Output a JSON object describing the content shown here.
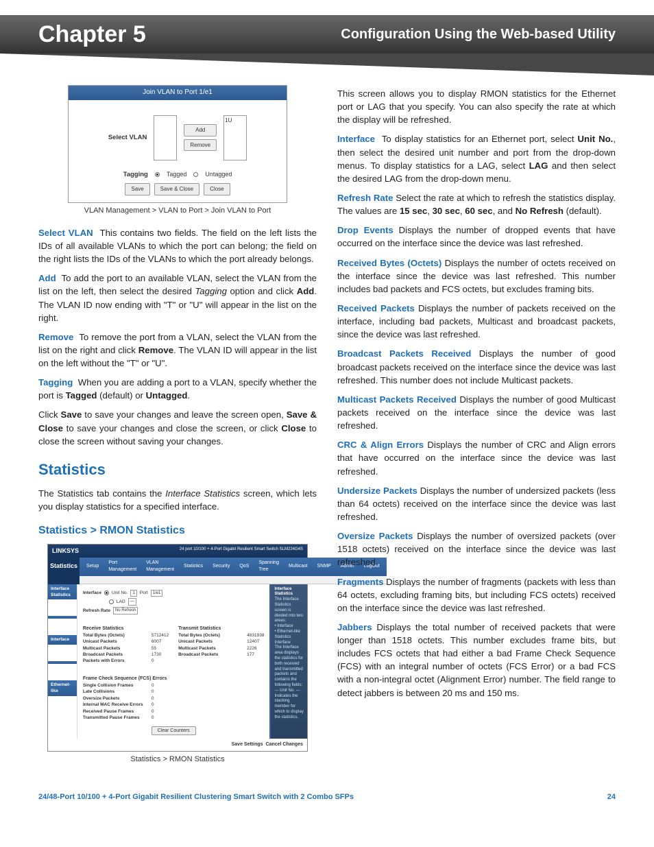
{
  "header": {
    "chapter": "Chapter 5",
    "title": "Configuration Using the Web-based Utility"
  },
  "fig1": {
    "title": "Join VLAN to Port 1/e1",
    "label": "Select VLAN",
    "rightVal": "1U",
    "add": "Add",
    "remove": "Remove",
    "taggingLabel": "Tagging",
    "tagged": "Tagged",
    "untagged": "Untagged",
    "save": "Save",
    "saveClose": "Save & Close",
    "close": "Close",
    "caption": "VLAN Management > VLAN to Port > Join VLAN to Port"
  },
  "left": {
    "selectVlan": {
      "t": "Select VLAN",
      "b": "This contains two fields. The field on the left lists the IDs of all available VLANs to which the port can belong; the field on the right lists the IDs of the VLANs to which the port already belongs."
    },
    "add": {
      "t": "Add",
      "b1": "To add the port to an available VLAN, select the VLAN from the list on the left, then select the desired ",
      "i": "Tagging",
      "b2": " option and click ",
      "bold": "Add",
      "b3": ". The VLAN ID now ending with \"T\" or \"U\" will appear in the list on the right."
    },
    "remove": {
      "t": "Remove",
      "b1": "To remove the port from a VLAN, select the VLAN from the list on the right and click ",
      "bold": "Remove",
      "b2": ". The VLAN ID will appear in the list on the left without the \"T\" or \"U\"."
    },
    "tagging": {
      "t": "Tagging",
      "b1": "When you are adding a port to a VLAN, specify whether the port is ",
      "bold1": "Tagged",
      "mid": " (default) or ",
      "bold2": "Untagged",
      "end": "."
    },
    "closeLine": {
      "a": "Click ",
      "save": "Save",
      "b": " to save your changes and leave the screen open, ",
      "sc": "Save & Close",
      "c": " to save your changes and close the screen, or click ",
      "close": "Close",
      "d": " to close the screen without saving your changes."
    },
    "statsH": "Statistics",
    "statsP": {
      "a": "The Statistics tab contains the ",
      "i": "Interface Statistics",
      "b": " screen, which lets you display statistics for a specified interface."
    },
    "rmonH": "Statistics > RMON Statistics",
    "fig2Caption": "Statistics > RMON Statistics"
  },
  "fig2": {
    "brand": "LINKSYS",
    "model": "24 port 10/100 + 4-Port Gigabit Resilient Smart Switch    SLM224G4S",
    "sideTab": "Statistics",
    "navTabs": [
      "Setup",
      "Port Management",
      "VLAN Management",
      "Statistics",
      "Security",
      "QoS",
      "Spanning Tree",
      "Multicast",
      "SNMP",
      "Admin",
      "LogOut"
    ],
    "sideItems": [
      "Interface Statistics",
      "",
      "Interface",
      "",
      "Ethernet-like"
    ],
    "ifaceLabel": "Interface",
    "unit": "Unit No.",
    "unitV": "1",
    "port": "Port",
    "portV": "1/e1",
    "lag": "LAG",
    "refresh": "Refresh Rate",
    "refreshV": "No Refresh",
    "recvH": "Receive Statistics",
    "transH": "Transmit Statistics",
    "recvRows": [
      [
        "Total Bytes (Octets)",
        "5712412"
      ],
      [
        "Unicast Packets",
        "6007"
      ],
      [
        "Multicast Packets",
        "55"
      ],
      [
        "Broadcast Packets",
        "1730"
      ],
      [
        "Packets with Errors",
        "0"
      ]
    ],
    "transRows": [
      [
        "Total Bytes (Octets)",
        "4831938"
      ],
      [
        "Unicast Packets",
        "12407"
      ],
      [
        "Multicast Packets",
        "2226"
      ],
      [
        "Broadcast Packets",
        "177"
      ]
    ],
    "ethH": "Frame Check Sequence (FCS) Errors",
    "ethRows": [
      [
        "Single Collision Frames",
        "0"
      ],
      [
        "Late Collisions",
        "0"
      ],
      [
        "Oversize Packets",
        "0"
      ],
      [
        "Internal MAC Receive Errors",
        "0"
      ],
      [
        "Received Pause Frames",
        "0"
      ],
      [
        "Transmitted Pause Frames",
        "0"
      ]
    ],
    "clear": "Clear Counters",
    "saveSettings": "Save Settings",
    "cancel": "Cancel Changes",
    "helpTitle": "Interface Statistics",
    "helpLines": [
      "The Interface Statistics screen is divided into two areas:",
      "• Interface",
      "• Ethernet-like Statistics",
      "Interface",
      "The Interface area displays the statistics for both received and transmitted packets and contains the following fields:",
      "— Unit No. — Indicates the stacking member for which to display the statistics."
    ]
  },
  "right": {
    "intro": "This screen allows you to display RMON statistics for the Ethernet port or LAG that you specify. You can also specify the rate at which the display will be refreshed.",
    "iface": {
      "t": "Interface",
      "a": "To display statistics for an Ethernet port, select ",
      "b1": "Unit No.",
      "b": ", then select the desired unit number and port from the drop-down menus. To display statistics for a LAG, select ",
      "b2": "LAG",
      "c": " and then select the desired LAG from the drop-down menu."
    },
    "refresh": {
      "t": "Refresh Rate",
      "a": "Select the rate at which to refresh the statistics display. The values are ",
      "v1": "15 sec",
      "s": ", ",
      "v2": "30 sec",
      "v3": "60 sec",
      "b": ", and ",
      "v4": "No Refresh",
      "c": " (default)."
    },
    "drop": {
      "t": "Drop Events",
      "b": "Displays the number of dropped events that have occurred on the interface since the device was last refreshed."
    },
    "rbytes": {
      "t": "Received Bytes (Octets)",
      "b": "Displays the number of octets received on the interface since the device was last refreshed. This number includes bad packets and FCS octets, but excludes framing bits."
    },
    "rpkts": {
      "t": "Received Packets",
      "b": "Displays the number of packets received on the interface, including bad packets, Multicast and broadcast packets, since the device was last refreshed."
    },
    "bcast": {
      "t": "Broadcast Packets Received",
      "b": "Displays the number of good broadcast packets received on the interface since the device was last refreshed. This number does not include Multicast packets."
    },
    "mcast": {
      "t": "Multicast Packets Received",
      "b": "Displays the number of good Multicast packets received on the interface since the device was last refreshed."
    },
    "crc": {
      "t": "CRC & Align Errors",
      "b": "Displays the number of CRC and Align errors that have occurred on the interface since the device was last refreshed."
    },
    "under": {
      "t": "Undersize Packets",
      "b": "Displays the number of undersized packets (less than 64 octets) received on the interface since the device was last refreshed."
    },
    "over": {
      "t": "Oversize Packets",
      "b": "Displays the number of oversized packets (over 1518 octets) received on the interface since the device was last refreshed."
    },
    "frag": {
      "t": "Fragments",
      "b": "Displays the number of fragments (packets with less than 64 octets, excluding framing bits, but including FCS octets) received on the interface since the device was last refreshed."
    },
    "jab": {
      "t": "Jabbers",
      "b": "Displays the total number of received packets that were longer than 1518 octets. This number excludes frame bits, but includes FCS octets that had either a bad Frame Check Sequence (FCS) with an integral number of octets (FCS Error) or a bad FCS with a non-integral octet (Alignment Error) number. The field range to detect jabbers is between 20 ms and 150 ms."
    }
  },
  "footer": {
    "product": "24/48-Port 10/100 + 4-Port Gigabit Resilient Clustering Smart Switch with 2 Combo SFPs",
    "page": "24"
  }
}
